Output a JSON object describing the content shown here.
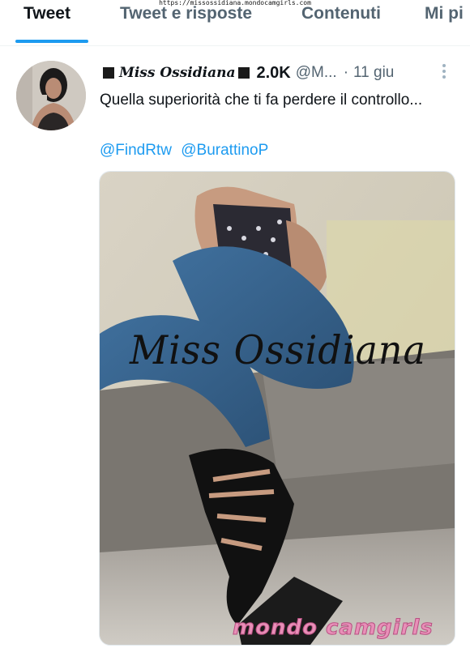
{
  "url_bar": "https://missossidiana.mondocamgirls.com",
  "tabs": [
    {
      "label": "Tweet",
      "active": true
    },
    {
      "label": "Tweet e risposte",
      "active": false
    },
    {
      "label": "Contenuti",
      "active": false
    },
    {
      "label": "Mi pi",
      "active": false
    }
  ],
  "tweet": {
    "display_name": "Miss Ossidiana",
    "follower_count": "2.0K",
    "handle": "@M...",
    "separator": "·",
    "date": "11 giu",
    "text": "Quella superiorità che ti fa perdere il controllo...",
    "mentions": [
      "@FindRtw",
      "@BurattinoP"
    ],
    "media_watermark": "Miss Ossidiana"
  },
  "site_watermark": "mondo camgirls",
  "colors": {
    "accent": "#1d9bf0",
    "secondary_text": "#536471",
    "primary_text": "#0f1419"
  },
  "icons": {
    "more": "more-vertical-icon"
  }
}
